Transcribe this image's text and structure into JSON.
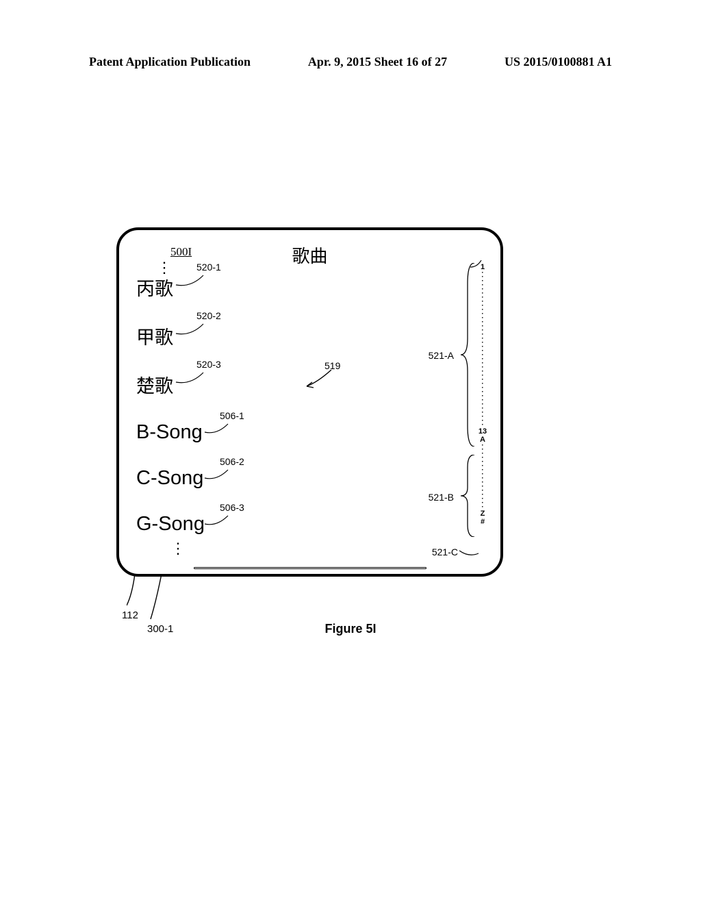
{
  "header": {
    "left": "Patent Application Publication",
    "center": "Apr. 9, 2015  Sheet 16 of 27",
    "right": "US 2015/0100881 A1"
  },
  "figure": {
    "number": "500I",
    "caption": "Figure 5I",
    "screen_title": "歌曲"
  },
  "songs_cjk": [
    {
      "label": "丙歌",
      "ref": "520-1"
    },
    {
      "label": "甲歌",
      "ref": "520-2"
    },
    {
      "label": "楚歌",
      "ref": "520-3"
    }
  ],
  "songs_latin": [
    {
      "label": "B-Song",
      "ref": "506-1"
    },
    {
      "label": "C-Song",
      "ref": "506-2"
    },
    {
      "label": "G-Song",
      "ref": "506-3"
    }
  ],
  "point_ref": "519",
  "index": {
    "top": "1",
    "mid_top": "13",
    "mid_a": "A",
    "bot_z": "Z",
    "bot_hash": "#"
  },
  "braces": {
    "a": "521-A",
    "b": "521-B",
    "c": "521-C"
  },
  "bottom_refs": {
    "left": "112",
    "mid": "300-1"
  }
}
